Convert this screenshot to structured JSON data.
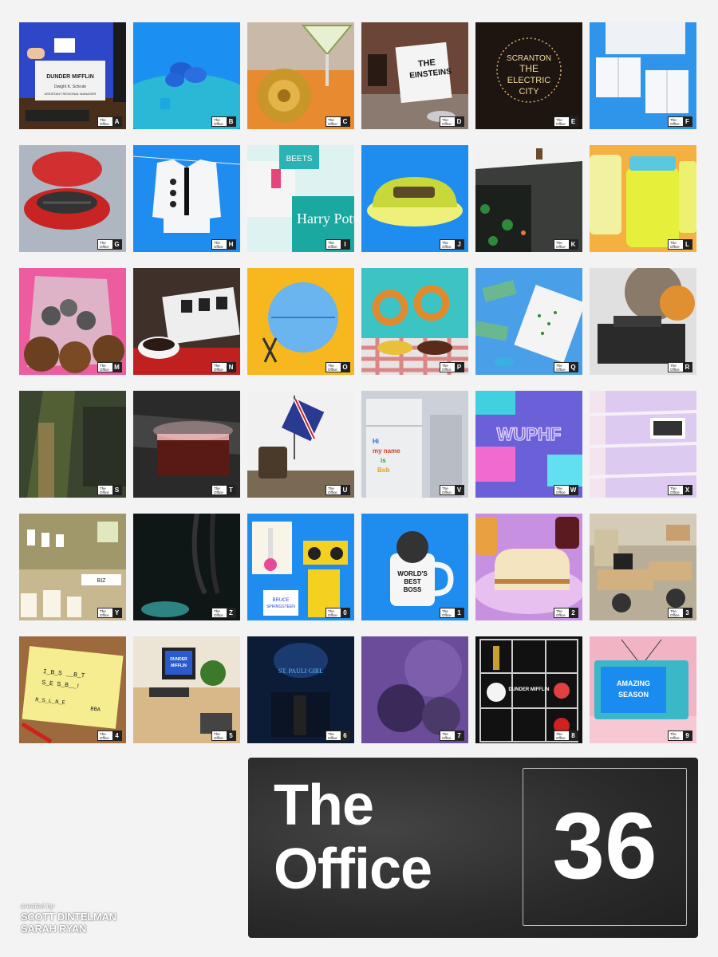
{
  "poster": {
    "title_line1": "The",
    "title_line2": "Office",
    "number": "36",
    "credits_label": "created by",
    "credit_1": "SCOTT DINTELMAN",
    "credit_2": "SARAH RYAN"
  },
  "badge_text": "The Office",
  "tiles": [
    {
      "label": "A",
      "icon": "dunder-mifflin-business-card",
      "text": [
        "DUNDER MIFFLIN",
        "DUNDER MIFFLIN",
        "Dwight K. Schrute",
        "ASSISTANT",
        "REGIONAL MANAGER"
      ]
    },
    {
      "label": "B",
      "icon": "blue-flower-stapler",
      "text": []
    },
    {
      "label": "C",
      "icon": "margarita-onion-blossom",
      "text": []
    },
    {
      "label": "D",
      "icon": "the-einsteins-sign",
      "text": [
        "THE",
        "EINSTEINS"
      ]
    },
    {
      "label": "E",
      "icon": "scranton-electric-city-sign",
      "text": [
        "SCRANTON",
        "THE",
        "ELECTRIC",
        "CITY"
      ]
    },
    {
      "label": "F",
      "icon": "wrapped-boxes",
      "text": []
    },
    {
      "label": "G",
      "icon": "george-foreman-grill",
      "text": []
    },
    {
      "label": "H",
      "icon": "shirt-on-clothesline",
      "text": []
    },
    {
      "label": "I",
      "icon": "harry-potter-book-beets",
      "text": [
        "BEETS",
        "Harry Pott"
      ]
    },
    {
      "label": "J",
      "icon": "stapler-in-jello",
      "text": []
    },
    {
      "label": "K",
      "icon": "koi-pond-office",
      "text": []
    },
    {
      "label": "L",
      "icon": "mayonnaise-jars",
      "text": []
    },
    {
      "label": "M",
      "icon": "pretzel-bag-cookies",
      "text": []
    },
    {
      "label": "N",
      "icon": "sushi-plate",
      "text": []
    },
    {
      "label": "O",
      "icon": "blue-ball-scissors",
      "text": []
    },
    {
      "label": "P",
      "icon": "pretzel-dips",
      "text": []
    },
    {
      "label": "Q",
      "icon": "money-dollar-bills",
      "text": []
    },
    {
      "label": "R",
      "icon": "exploding-printer",
      "text": []
    },
    {
      "label": "S",
      "icon": "dark-spotlight-pedestal",
      "text": []
    },
    {
      "label": "T",
      "icon": "glowing-chest",
      "text": []
    },
    {
      "label": "U",
      "icon": "union-jack-flag-desk",
      "text": []
    },
    {
      "label": "V",
      "icon": "fridge-magnets",
      "text": [
        "Hi",
        "my name",
        "is",
        "Bob"
      ]
    },
    {
      "label": "W",
      "icon": "neon-wuphf",
      "text": [
        "WUPHF"
      ]
    },
    {
      "label": "X",
      "icon": "blinds-pictures",
      "text": []
    },
    {
      "label": "Y",
      "icon": "candles",
      "text": [
        "BIZ"
      ]
    },
    {
      "label": "Z",
      "icon": "dark-hanging-cords",
      "text": []
    },
    {
      "label": "0",
      "icon": "thermometer-boombox",
      "text": [
        "BRUCE",
        "SPRINGSTEEN"
      ]
    },
    {
      "label": "1",
      "icon": "worlds-best-boss-mug",
      "text": [
        "WORLD'S",
        "BEST",
        "BOSS"
      ]
    },
    {
      "label": "2",
      "icon": "peanut-butter-sandwich",
      "text": []
    },
    {
      "label": "3",
      "icon": "office-desks",
      "text": []
    },
    {
      "label": "4",
      "icon": "yellow-notepad",
      "text": [
        "I_B_S  __B_T",
        "S_E  S_B__!",
        "R_S_L_N_E",
        "BBA"
      ]
    },
    {
      "label": "5",
      "icon": "dunder-mifflin-computer",
      "text": [
        "DUNDER",
        "MIFFLIN"
      ]
    },
    {
      "label": "6",
      "icon": "st-pauli-girl-sign",
      "text": [
        "ST. PAULI GIRL"
      ]
    },
    {
      "label": "7",
      "icon": "purple-underwater",
      "text": []
    },
    {
      "label": "8",
      "icon": "shelf-of-items",
      "text": [
        "DUNDER MIFFLIN"
      ]
    },
    {
      "label": "9",
      "icon": "amazing-season-tv",
      "text": [
        "AMAZING",
        "SEASON"
      ]
    }
  ]
}
